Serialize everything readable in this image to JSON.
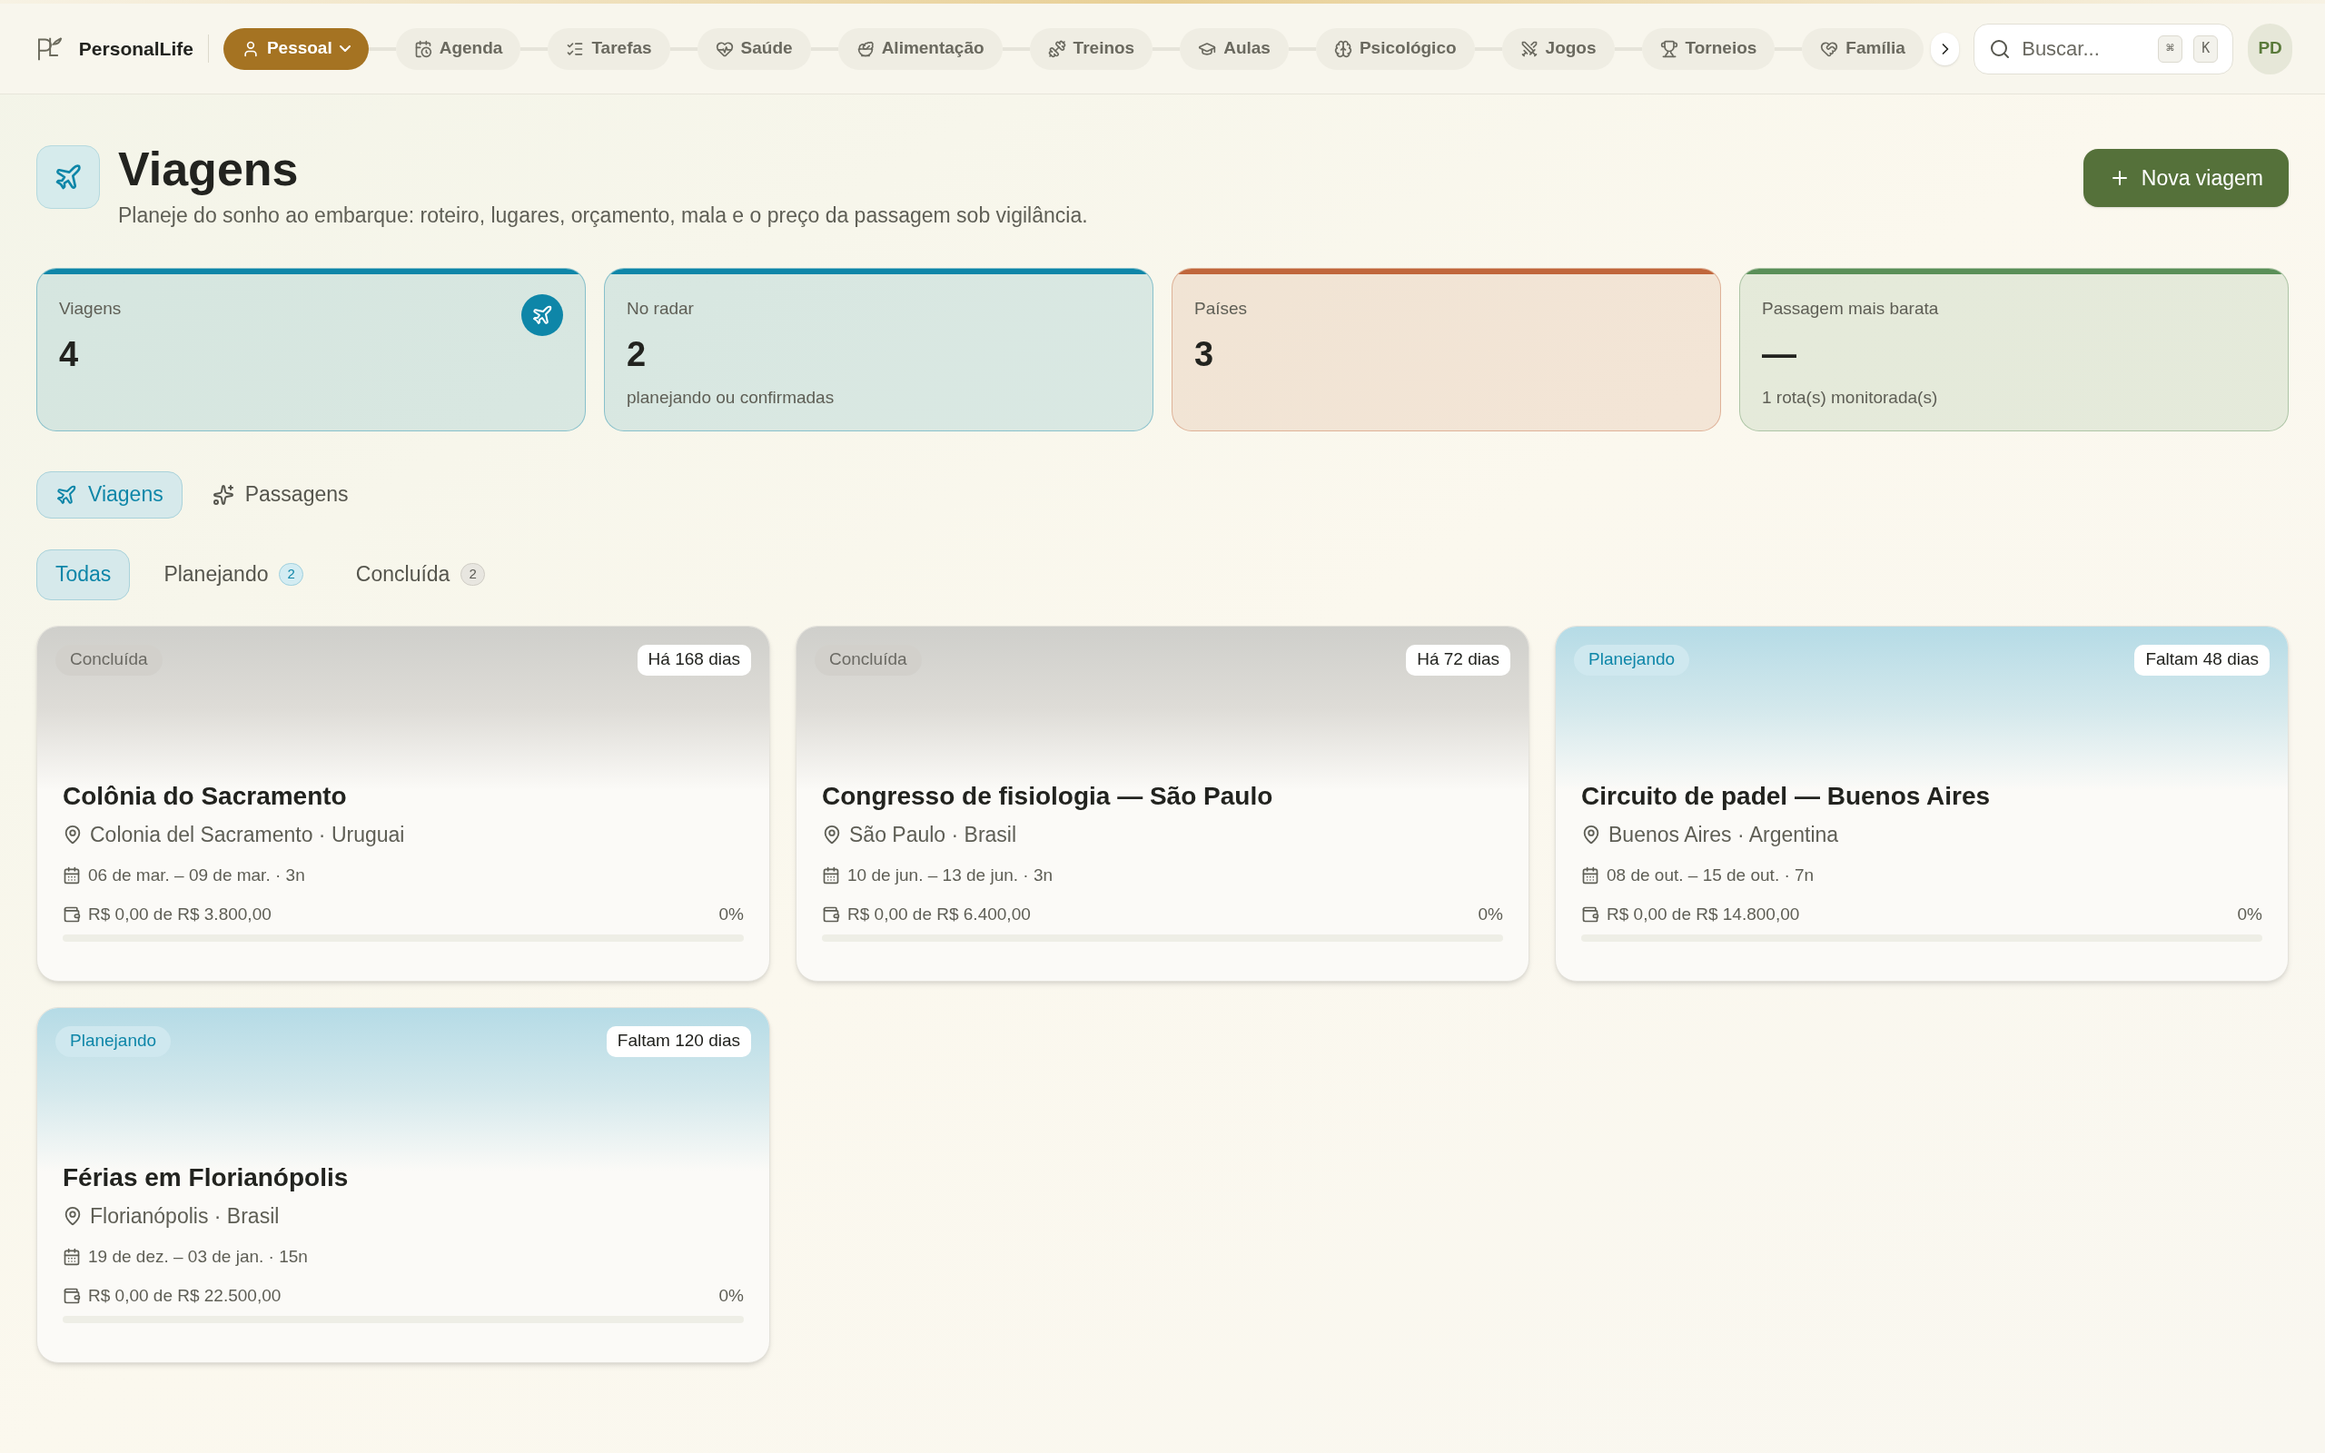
{
  "brand": "PersonalLife",
  "nav": {
    "items": [
      {
        "label": "Pessoal",
        "selected": true
      },
      {
        "label": "Agenda",
        "selected": false
      },
      {
        "label": "Tarefas",
        "selected": false
      },
      {
        "label": "Saúde",
        "selected": false
      },
      {
        "label": "Alimentação",
        "selected": false
      },
      {
        "label": "Treinos",
        "selected": false
      },
      {
        "label": "Aulas",
        "selected": false
      },
      {
        "label": "Psicológico",
        "selected": false
      },
      {
        "label": "Jogos",
        "selected": false
      },
      {
        "label": "Torneios",
        "selected": false
      },
      {
        "label": "Família",
        "selected": false
      }
    ],
    "search": {
      "placeholder": "Buscar...",
      "keys": [
        "⌘",
        "K"
      ]
    },
    "avatar": "PD"
  },
  "header": {
    "title": "Viagens",
    "subtitle": "Planeje do sonho ao embarque: roteiro, lugares, orçamento, mala e o preço da passagem sob vigilância.",
    "action": "Nova viagem"
  },
  "stats": [
    {
      "label": "Viagens",
      "value": "4",
      "color": "#0e86a8",
      "has_icon": true
    },
    {
      "label": "No radar",
      "value": "2",
      "note": "planejando ou confirmadas",
      "color": "#0e86a8",
      "has_icon": false
    },
    {
      "label": "Países",
      "value": "3",
      "color": "#c0663b",
      "has_icon": false
    },
    {
      "label": "Passagem mais barata",
      "value": "—",
      "note": "1 rota(s) monitorada(s)",
      "color": "#5a8f58",
      "has_icon": false
    }
  ],
  "view_tabs": [
    {
      "label": "Viagens",
      "selected": true
    },
    {
      "label": "Passagens",
      "selected": false
    }
  ],
  "filters": [
    {
      "label": "Todas",
      "selected": true
    },
    {
      "label": "Planejando",
      "count": "2",
      "kind": "planning",
      "selected": false
    },
    {
      "label": "Concluída",
      "count": "2",
      "kind": "done",
      "selected": false
    }
  ],
  "trips": [
    {
      "status": "Concluída",
      "kind": "done",
      "days": "Há 168 dias",
      "title": "Colônia do Sacramento",
      "location": "Colonia del Sacramento · Uruguai",
      "dates": "06 de mar. – 09 de mar. · 3n",
      "budget": "R$ 0,00 de R$ 3.800,00",
      "percent": "0%",
      "level": 0
    },
    {
      "status": "Concluída",
      "kind": "done",
      "days": "Há 72 dias",
      "title": "Congresso de fisiologia — São Paulo",
      "location": "São Paulo · Brasil",
      "dates": "10 de jun. – 13 de jun. · 3n",
      "budget": "R$ 0,00 de R$ 6.400,00",
      "percent": "0%",
      "level": 0
    },
    {
      "status": "Planejando",
      "kind": "planning",
      "days": "Faltam 48 dias",
      "title": "Circuito de padel — Buenos Aires",
      "location": "Buenos Aires · Argentina",
      "dates": "08 de out. – 15 de out. · 7n",
      "budget": "R$ 0,00 de R$ 14.800,00",
      "percent": "0%",
      "level": 0
    },
    {
      "status": "Planejando",
      "kind": "planning",
      "days": "Faltam 120 dias",
      "title": "Férias em Florianópolis",
      "location": "Florianópolis · Brasil",
      "dates": "19 de dez. – 03 de jan. · 15n",
      "budget": "R$ 0,00 de R$ 22.500,00",
      "percent": "0%",
      "level": 0
    }
  ]
}
